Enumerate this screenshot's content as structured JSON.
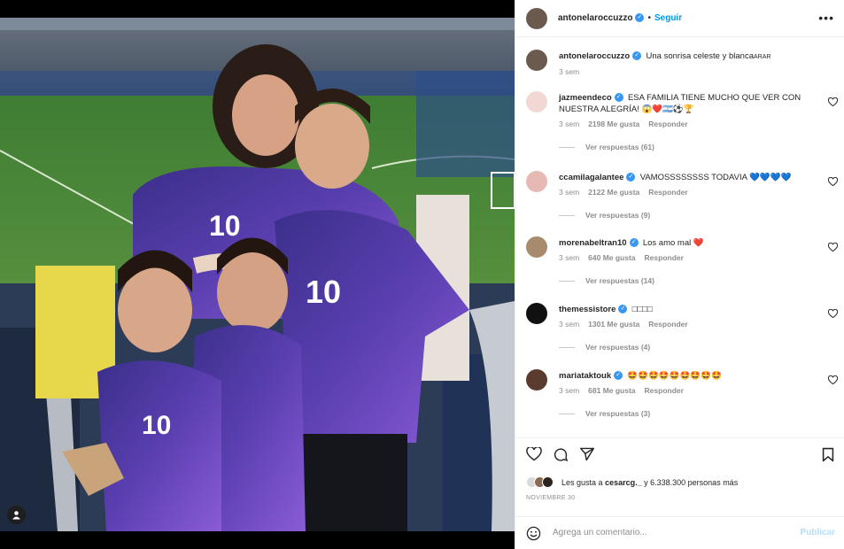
{
  "post": {
    "author": "antonelaroccuzzo",
    "follow_label": "Seguir",
    "caption_user": "antonelaroccuzzo",
    "caption_text": "Una sonrisa celeste y blanca",
    "caption_flag": "ARAR",
    "caption_time": "3 sem"
  },
  "comments": [
    {
      "user": "jazmeendeco",
      "verified": true,
      "text": "ESA FAMILIA TIENE MUCHO QUE VER CON NUESTRA ALEGRÍA! 😱❤️🇦🇷⚽🏆",
      "time": "3 sem",
      "likes": "2198 Me gusta",
      "reply": "Responder",
      "replies": "Ver respuestas (61)",
      "avatar_color": "#f2d8d4"
    },
    {
      "user": "ccamilagalantee",
      "verified": true,
      "text": "VAMOSSSSSSSS TODAVIA 💙💙💙💙",
      "time": "3 sem",
      "likes": "2122 Me gusta",
      "reply": "Responder",
      "replies": "Ver respuestas (9)",
      "avatar_color": "#e7b9b4"
    },
    {
      "user": "morenabeltran10",
      "verified": true,
      "text": "Los amo mal ❤️",
      "time": "3 sem",
      "likes": "640 Me gusta",
      "reply": "Responder",
      "replies": "Ver respuestas (14)",
      "avatar_color": "#a88a6c"
    },
    {
      "user": "themessistore",
      "verified": true,
      "text": "□□□□",
      "time": "3 sem",
      "likes": "1301 Me gusta",
      "reply": "Responder",
      "replies": "Ver respuestas (4)",
      "avatar_color": "#111111"
    },
    {
      "user": "mariataktouk",
      "verified": true,
      "text": "🤩🤩🤩🤩🤩🤩🤩🤩🤩",
      "time": "3 sem",
      "likes": "681 Me gusta",
      "reply": "Responder",
      "replies": "Ver respuestas (3)",
      "avatar_color": "#5a3b2e"
    }
  ],
  "likes": {
    "prefix": "Les gusta a",
    "user": "cesarcg._",
    "suffix": "y 6.338.300 personas más"
  },
  "date": "NOVIEMBRE 30",
  "add_comment": {
    "placeholder": "Agrega un comentario...",
    "publish": "Publicar"
  },
  "icons": {
    "like": "heart-icon",
    "comment": "comment-icon",
    "share": "paper-plane-icon",
    "save": "bookmark-icon",
    "emoji": "smiley-icon",
    "more": "more-icon"
  },
  "colors": {
    "link": "#0095f6",
    "verified": "#3897f0",
    "muted": "#8e8e8e",
    "heart_red": "#ed4956"
  }
}
